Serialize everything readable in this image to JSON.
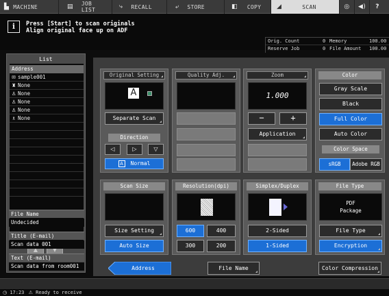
{
  "tabs": [
    {
      "label": "MACHINE",
      "icon": "machine-icon"
    },
    {
      "label": "JOB LIST",
      "icon": "job-list-icon"
    },
    {
      "label": "RECALL",
      "icon": "recall-icon"
    },
    {
      "label": "STORE",
      "icon": "store-icon"
    },
    {
      "label": "COPY",
      "icon": "copy-icon"
    },
    {
      "label": "SCAN",
      "icon": "scan-icon"
    }
  ],
  "message": {
    "icon": "i",
    "line1": "Press [Start] to scan originals",
    "line2": "Align original face up on ADF"
  },
  "status": {
    "orig_count_label": "Orig. Count",
    "orig_count_value": "0",
    "memory_label": "Memory",
    "memory_value": "100.00",
    "reserve_job_label": "Reserve Job",
    "reserve_job_value": "0",
    "file_amount_label": "File Amount",
    "file_amount_value": "100.00"
  },
  "list": {
    "title": "List",
    "header": "Address",
    "items": [
      {
        "label": "sample001",
        "icon": "email-icon"
      },
      {
        "label": "None",
        "icon": "box-icon"
      },
      {
        "label": "None",
        "icon": "network-icon"
      },
      {
        "label": "None",
        "icon": "network-icon"
      },
      {
        "label": "None",
        "icon": "network-icon"
      },
      {
        "label": "None",
        "icon": "group-icon"
      }
    ],
    "scroll_up": "▲",
    "scroll_down": "▼"
  },
  "info": {
    "file_name_label": "File Name",
    "file_name_value": "Undecided",
    "title_label": "Title (E-mail)",
    "title_value": "Scan data 001",
    "text_label": "Text (E-mail)",
    "text_value": "Scan data from room001"
  },
  "original_setting": {
    "title": "Original Setting",
    "separate_scan": "Separate Scan",
    "direction_title": "Direction",
    "normal_label": "Normal",
    "original_glyph": "A"
  },
  "quality": {
    "title": "Quality Adj."
  },
  "zoom": {
    "title": "Zoom",
    "value": "1.000",
    "minus": "−",
    "plus": "+",
    "application": "Application"
  },
  "color": {
    "title": "Color",
    "gray_scale": "Gray Scale",
    "black": "Black",
    "full_color": "Full Color",
    "auto_color": "Auto Color",
    "color_space_title": "Color Space",
    "srgb": "sRGB",
    "adobe_rgb": "Adobe RGB"
  },
  "scan_size": {
    "title": "Scan Size",
    "size_setting": "Size Setting",
    "auto_size": "Auto Size"
  },
  "resolution": {
    "title": "Resolution(dpi)",
    "r600": "600",
    "r400": "400",
    "r300": "300",
    "r200": "200"
  },
  "simplex": {
    "title": "Simplex/Duplex",
    "two_sided": "2-Sided",
    "one_sided": "1-Sided"
  },
  "file_type": {
    "title": "File Type",
    "current_line1": "PDF",
    "current_line2": "Package",
    "file_type_btn": "File Type",
    "encryption": "Encryption"
  },
  "bottom": {
    "address": "Address",
    "file_name": "File Name",
    "color_compression": "Color Compression"
  },
  "footer": {
    "time": "17:23",
    "status": "Ready to receive"
  }
}
